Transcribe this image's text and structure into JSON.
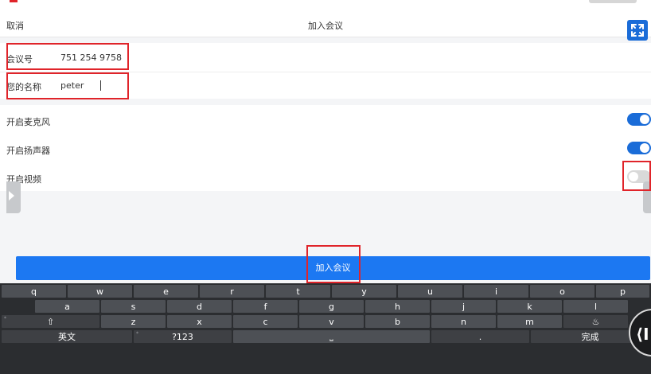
{
  "header": {
    "cancel_label": "取消",
    "title": "加入会议",
    "fullscreen_icon": "expand-arrows-icon"
  },
  "meeting": {
    "label": "会议号",
    "value": "751 254 9758"
  },
  "name": {
    "label": "您的名称",
    "value": "peter"
  },
  "toggles": [
    {
      "label": "开启麦克风",
      "on": true
    },
    {
      "label": "开启扬声器",
      "on": true
    },
    {
      "label": "开启视频",
      "on": false
    }
  ],
  "join_button_label": "加入会议",
  "colors": {
    "accent": "#1c78f2",
    "highlight": "#e0242a"
  },
  "keyboard": {
    "row1": [
      "q",
      "w",
      "e",
      "r",
      "t",
      "y",
      "u",
      "i",
      "o",
      "p"
    ],
    "row2": [
      "a",
      "s",
      "d",
      "f",
      "g",
      "h",
      "j",
      "k",
      "l"
    ],
    "row3": [
      "⇧",
      "z",
      "x",
      "c",
      "v",
      "b",
      "n",
      "m",
      "♨"
    ],
    "bottom": {
      "lang": "英文",
      "symbols": "?123",
      "space": "⎵",
      "period": ".",
      "done": "完成"
    },
    "hints": {
      "shift": "*",
      "symbols": "*"
    },
    "round_button_glyph": "⟨I"
  }
}
